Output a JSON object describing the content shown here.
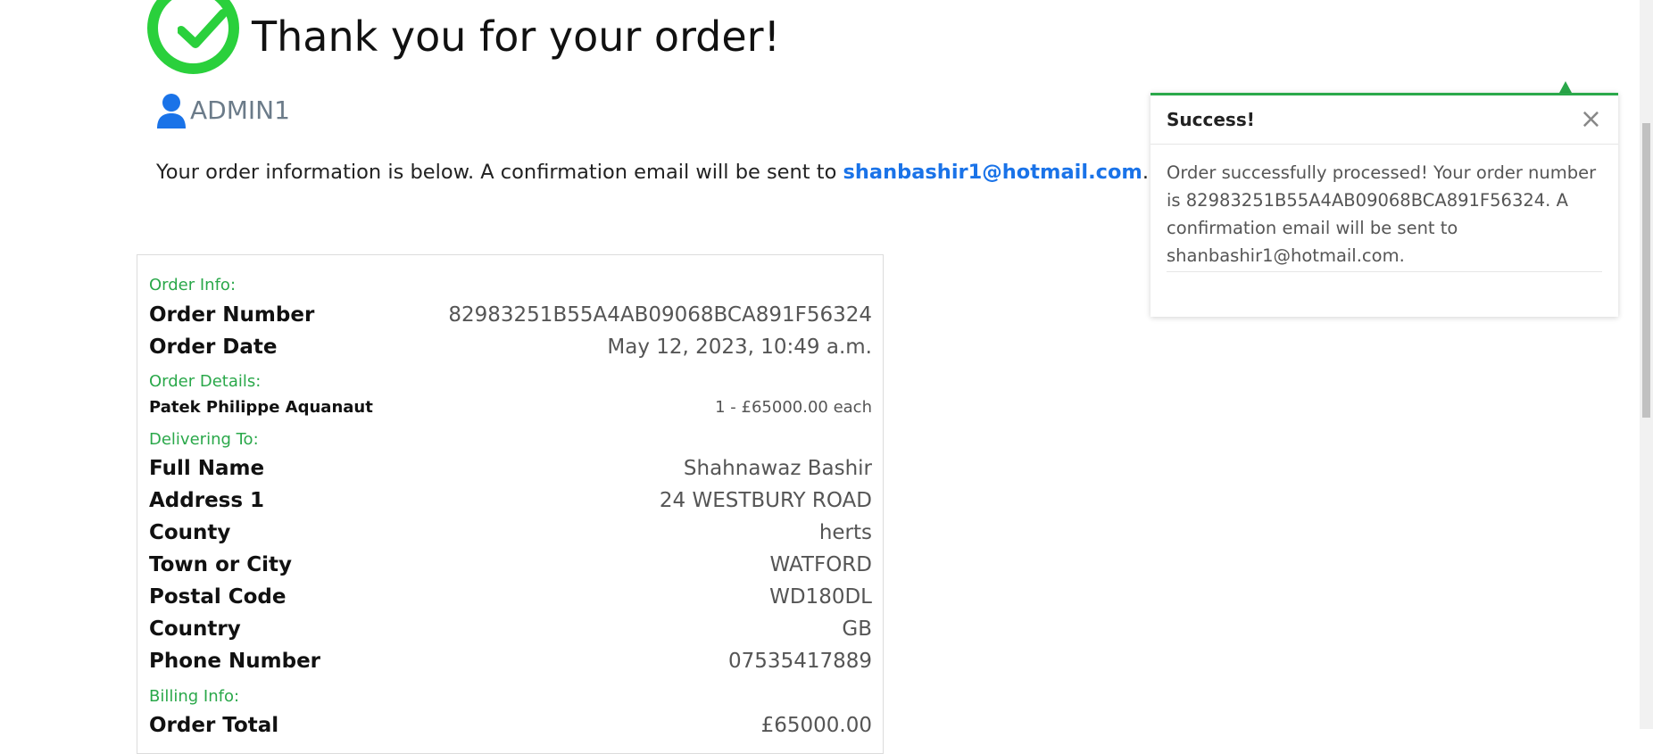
{
  "header": {
    "title": "Thank you for your order!",
    "username": "ADMIN1"
  },
  "intro": {
    "text": "Your order information is below. A confirmation email will be sent to ",
    "email": "shanbashir1@hotmail.com",
    "suffix": "."
  },
  "order": {
    "sections": {
      "order_info": "Order Info:",
      "order_details": "Order Details:",
      "delivering_to": "Delivering To:",
      "billing_info": "Billing Info:"
    },
    "order_number": {
      "label": "Order Number",
      "value": "82983251B55A4AB09068BCA891F56324"
    },
    "order_date": {
      "label": "Order Date",
      "value": "May 12, 2023, 10:49 a.m."
    },
    "item": {
      "label": "Patek Philippe Aquanaut",
      "value": "1 - £65000.00 each"
    },
    "full_name": {
      "label": "Full Name",
      "value": "Shahnawaz Bashir"
    },
    "address1": {
      "label": "Address 1",
      "value": "24 WESTBURY ROAD"
    },
    "county": {
      "label": "County",
      "value": "herts"
    },
    "town": {
      "label": "Town or City",
      "value": "WATFORD"
    },
    "postal": {
      "label": "Postal Code",
      "value": "WD180DL"
    },
    "country": {
      "label": "Country",
      "value": "GB"
    },
    "phone": {
      "label": "Phone Number",
      "value": "07535417889"
    },
    "total": {
      "label": "Order Total",
      "value": "£65000.00"
    }
  },
  "toast": {
    "title": "Success!",
    "close": "×",
    "message": "Order successfully processed! Your order number is 82983251B55A4AB09068BCA891F56324. A confirmation email will be sent to shanbashir1@hotmail.com."
  },
  "colors": {
    "accent_green": "#2aa84a",
    "check_green": "#2ad03c",
    "link_blue": "#1a73e8"
  },
  "icons": {
    "check": "check-icon",
    "user": "user-icon",
    "close": "close-icon"
  }
}
